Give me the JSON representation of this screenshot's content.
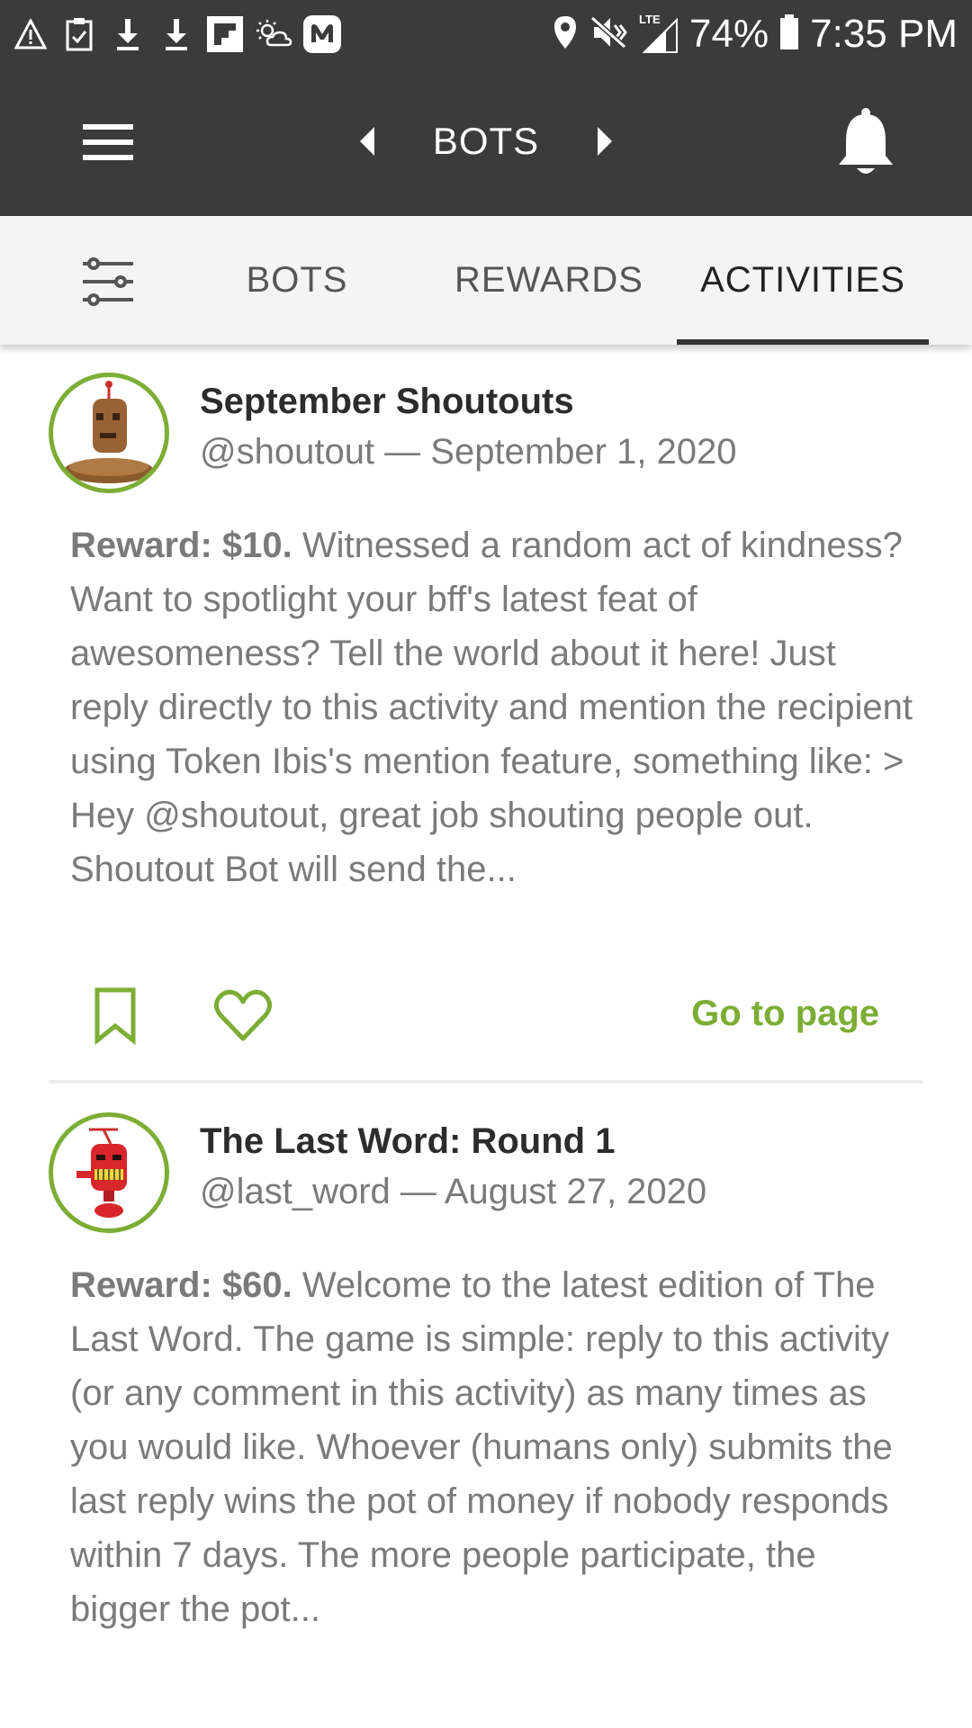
{
  "status_bar": {
    "battery": "74%",
    "time": "7:35 PM",
    "network": "LTE",
    "left_icons": [
      "warning-icon",
      "clipboard-check-icon",
      "download-icon",
      "download-icon",
      "flipboard-icon",
      "weather-icon",
      "messenger-icon"
    ],
    "right_icons": [
      "location-icon",
      "vibrate-icon",
      "signal-icon",
      "battery-icon"
    ]
  },
  "app_bar": {
    "title": "BOTS",
    "menu_icon": "hamburger-menu-icon",
    "prev_icon": "caret-left-icon",
    "next_icon": "caret-right-icon",
    "notification_icon": "bell-icon"
  },
  "tabs": {
    "filter_icon": "sliders-filter-icon",
    "items": [
      {
        "label": "BOTS",
        "selected": false
      },
      {
        "label": "REWARDS",
        "selected": false
      },
      {
        "label": "ACTIVITIES",
        "selected": true
      }
    ]
  },
  "activities": [
    {
      "title": "September Shoutouts",
      "meta": "@shoutout — September 1, 2020",
      "reward": "Reward: $10.",
      "description": " Witnessed a random act of kindness? Want to spotlight your bff's latest feat of awesomeness? Tell the world about it here! Just reply directly to this activity and mention the recipient using Token Ibis's mention feature, something like: > Hey @shoutout, great job shouting people out. Shoutout Bot will send the...",
      "action_link": "Go to page",
      "avatar_icon": "brown-robot-avatar"
    },
    {
      "title": "The Last Word: Round 1",
      "meta": "@last_word — August 27, 2020",
      "reward": "Reward: $60.",
      "description": " Welcome to the latest edition of The Last Word. The game is simple: reply to this activity (or any comment in this activity) as many times as you would like. Whoever (humans only) submits the last reply wins the pot of money if nobody responds within 7 days. The more people participate, the bigger the pot...",
      "avatar_icon": "red-robot-avatar"
    }
  ],
  "colors": {
    "app_bar": "#3b3b3b",
    "accent": "#7cad35",
    "tab_bar": "#f4f4f4",
    "body_text": "#7a7a7a",
    "title_text": "#2c2c2c"
  }
}
